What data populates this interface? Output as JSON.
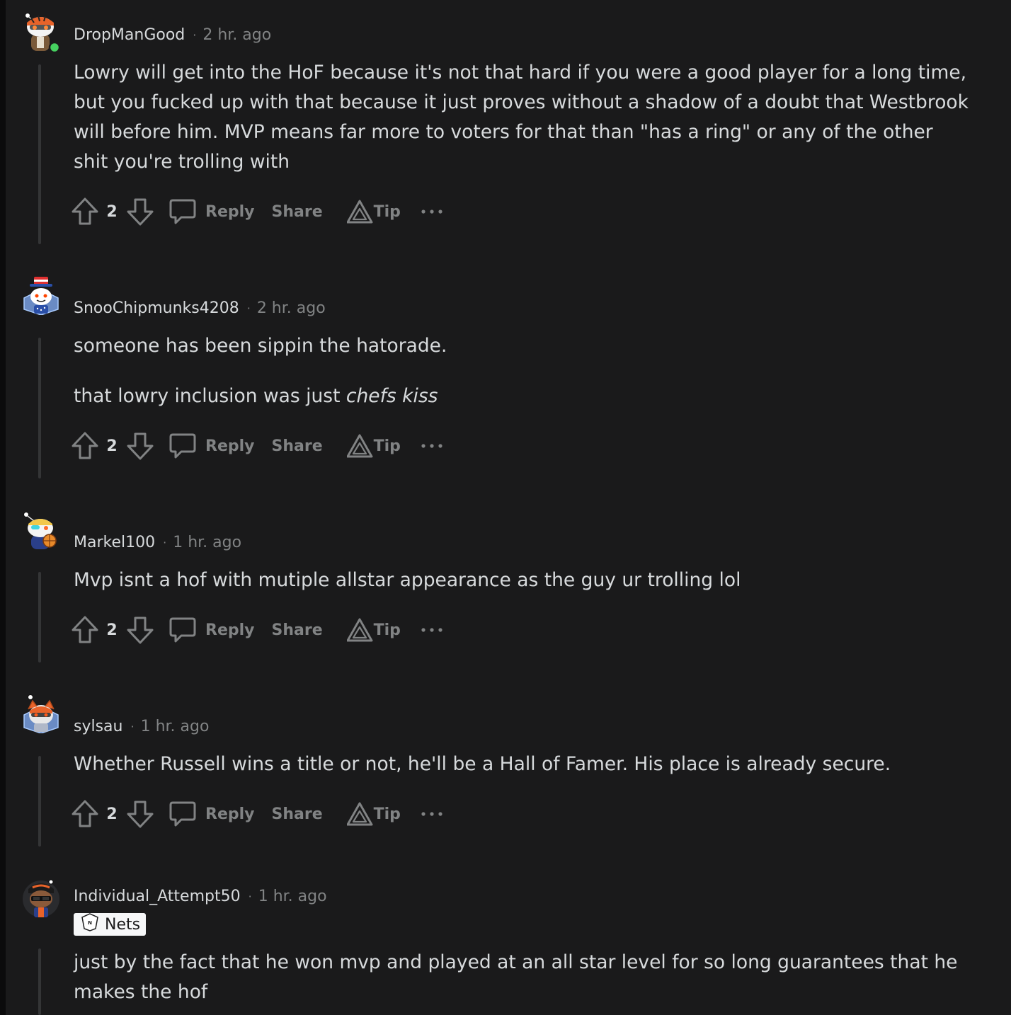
{
  "labels": {
    "reply": "Reply",
    "share": "Share",
    "tip": "Tip"
  },
  "comments": [
    {
      "username": "DropManGood",
      "time": "2 hr. ago",
      "online": true,
      "avatar_icon": "snoo-avatar-icon",
      "paragraphs": [
        "Lowry will get into the HoF because it's not that hard if you were a good player for a long time, but you fucked up with that because it just proves without a shadow of a doubt that Westbrook will before him. MVP means far more to voters for that than \"has a ring\" or any of the other shit you're trolling with"
      ],
      "score": "2"
    },
    {
      "username": "SnooChipmunks4208",
      "time": "2 hr. ago",
      "avatar_icon": "snoo-avatar-icon",
      "paragraph1": "someone has been sippin the hatorade.",
      "paragraph2_plain": "that lowry inclusion was just ",
      "paragraph2_italic": "chefs kiss",
      "score": "2"
    },
    {
      "username": "Markel100",
      "time": "1 hr. ago",
      "avatar_icon": "snoo-avatar-icon",
      "paragraphs": [
        "Mvp isnt a hof with mutiple allstar appearance as the guy ur trolling lol"
      ],
      "score": "2"
    },
    {
      "username": "sylsau",
      "time": "1 hr. ago",
      "avatar_icon": "snoo-avatar-icon",
      "paragraphs": [
        "Whether Russell wins a title or not, he'll be a Hall of Famer. His place is already secure."
      ],
      "score": "2"
    },
    {
      "username": "Individual_Attempt50",
      "time": "1 hr. ago",
      "avatar_icon": "snoo-avatar-icon",
      "flair": "Nets",
      "flair_icon": "nets-logo-icon",
      "paragraphs": [
        "just by the fact that he won mvp and played at an all star level for so long guarantees that he makes the hof"
      ]
    }
  ],
  "colors": {
    "background": "#1a1a1b",
    "text": "#d7dadc",
    "muted": "#818384",
    "thread_line": "#343536",
    "online": "#46d160"
  }
}
